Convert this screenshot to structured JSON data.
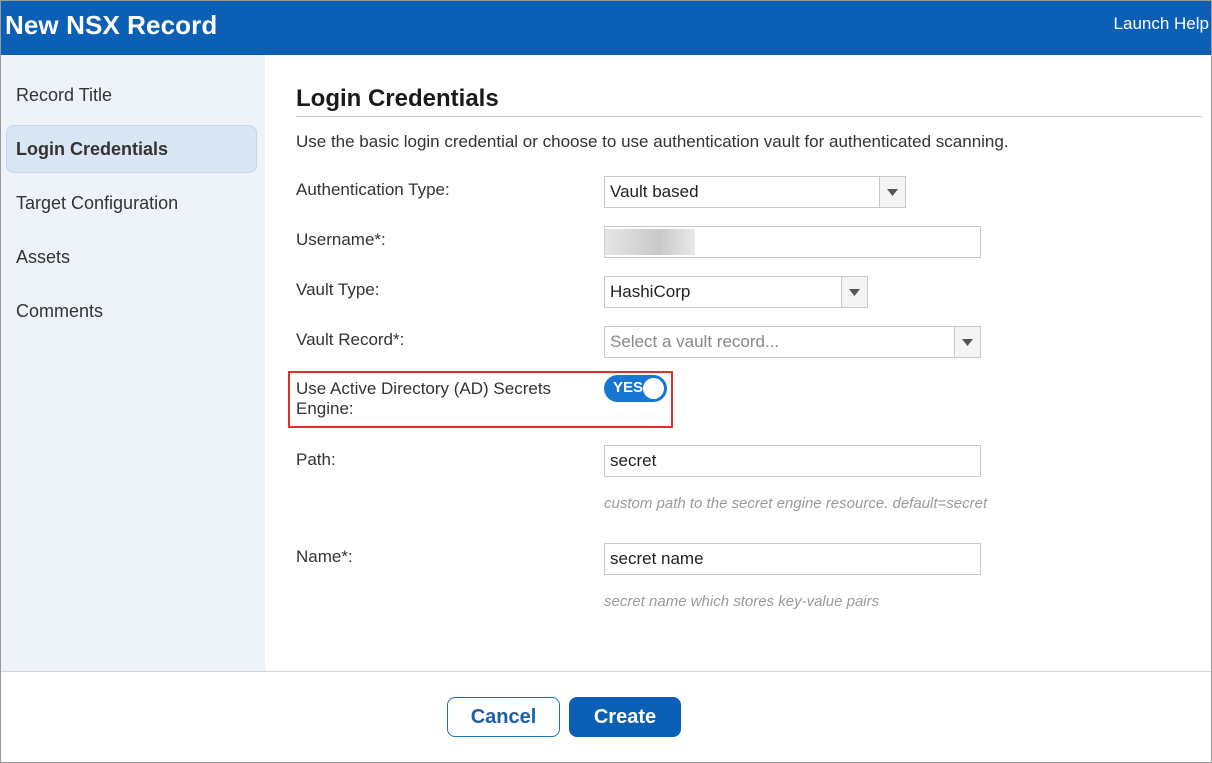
{
  "window": {
    "title": "New NSX Record",
    "help_link": "Launch Help"
  },
  "sidebar": {
    "items": [
      {
        "label": "Record Title",
        "active": false
      },
      {
        "label": "Login Credentials",
        "active": true
      },
      {
        "label": "Target Configuration",
        "active": false
      },
      {
        "label": "Assets",
        "active": false
      },
      {
        "label": "Comments",
        "active": false
      }
    ]
  },
  "main": {
    "section_title": "Login Credentials",
    "intro": "Use the basic login credential or choose to use authentication vault for authenticated scanning.",
    "fields": {
      "auth_type": {
        "label": "Authentication Type:",
        "value": "Vault based"
      },
      "username": {
        "label": "Username*:",
        "value": ""
      },
      "vault_type": {
        "label": "Vault Type:",
        "value": "HashiCorp"
      },
      "vault_record": {
        "label": "Vault Record*:",
        "placeholder": "Select a vault record..."
      },
      "ad_secrets": {
        "label": "Use Active Directory (AD) Secrets Engine:",
        "toggle_text": "YES",
        "enabled": true
      },
      "path": {
        "label": "Path:",
        "value": "secret",
        "hint": "custom path to the secret engine resource. default=secret"
      },
      "name": {
        "label": "Name*:",
        "value": "secret name",
        "hint": "secret name which stores key-value pairs"
      }
    }
  },
  "footer": {
    "cancel_label": "Cancel",
    "create_label": "Create"
  },
  "colors": {
    "brand": "#0b5fb4",
    "toggle_on": "#1776d2",
    "highlight": "#d9332e",
    "sidebar_bg": "#eef3f9"
  }
}
